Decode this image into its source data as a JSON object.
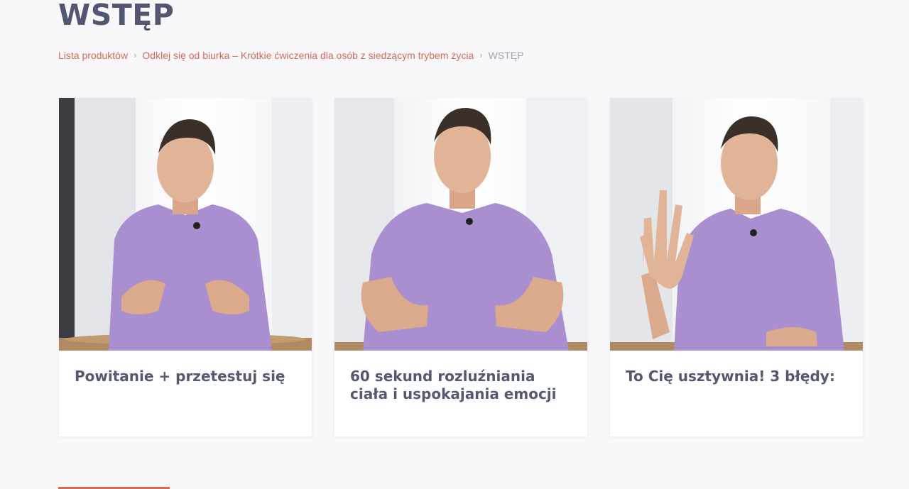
{
  "page": {
    "title": "WSTĘP"
  },
  "breadcrumb": {
    "items": [
      {
        "label": "Lista produktów"
      },
      {
        "label": "Odklej się od biurka – Krótkie ćwiczenia dla osób z siedzącym trybem życia"
      }
    ],
    "separator": "›",
    "current": "WSTĘP"
  },
  "lessons": [
    {
      "title": "Powitanie + przetestuj się",
      "thumbnail": "instructor-speaking-hands-open"
    },
    {
      "title": "60 sekund rozluźniania ciała i uspokajania emocji",
      "thumbnail": "instructor-hands-on-belly"
    },
    {
      "title": "To Cię usztywnia! 3 błędy:",
      "thumbnail": "instructor-raised-hand"
    }
  ],
  "colors": {
    "accent": "#d46a55",
    "heading": "#535670",
    "background": "#f8f8fb",
    "shirt": "#a98fd0"
  }
}
